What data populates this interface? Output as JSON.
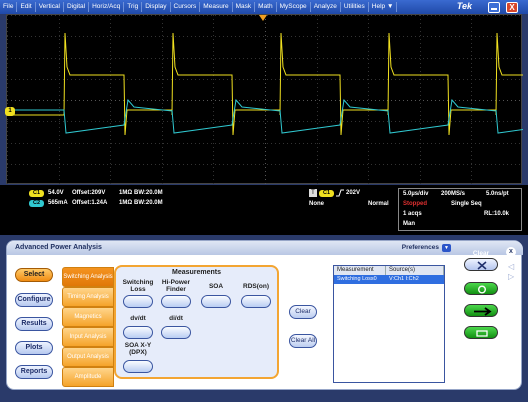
{
  "menu": [
    "File",
    "Edit",
    "Vertical",
    "Digital",
    "Horiz/Acq",
    "Trig",
    "Display",
    "Cursors",
    "Measure",
    "Mask",
    "Math",
    "MyScope",
    "Analyze",
    "Utilities",
    "Help"
  ],
  "help_arrow": "▼",
  "brand": "Tek",
  "close_glyph": "X",
  "colors": {
    "ch1": "#f0e020",
    "ch2": "#30c8d0",
    "accent": "#f39a1e",
    "menubar": "#2b5bc4"
  },
  "waveform": {
    "ch1_marker": "1",
    "icon_names": [
      "trigger-marker-icon",
      "ch1-ground-marker-icon",
      "ch2-ground-marker-icon"
    ]
  },
  "readout": {
    "ch1": {
      "badge": "C1",
      "scale": "54.0V",
      "offset": "Offset:209V",
      "impedance": "1MΩ",
      "bw": "BW:20.0M"
    },
    "ch2": {
      "badge": "C2",
      "scale": "565mA",
      "offset": "Offset:1.24A",
      "impedance": "1MΩ",
      "bw": "BW:20.0M"
    },
    "trigger": {
      "source": "C1",
      "level": "202V",
      "coupling": "None",
      "mode": "Normal",
      "slope_icon": "rising-edge-icon"
    },
    "acquisition": {
      "time_div": "5.0µs/div",
      "sample_rate": "200MS/s",
      "pt": "5.0ns/pt",
      "status": "Stopped",
      "seq": "Single Seq",
      "acqs": "1 acqs",
      "rl": "RL:10.0k",
      "mode": "Man"
    }
  },
  "panel": {
    "title": "Advanced Power Analysis",
    "preferences": "Preferences",
    "side_buttons": [
      "Select",
      "Configure",
      "Results",
      "Plots",
      "Reports"
    ],
    "tabs": [
      "Switching Analysis",
      "Timing Analysis",
      "Magnetics",
      "Input Analysis",
      "Output Analysis",
      "Amplitude"
    ],
    "measurements_heading": "Measurements",
    "measurements": [
      "Switching Loss",
      "Hi-Power Finder",
      "SOA",
      "RDS(on)",
      "dv/dt",
      "di/dt",
      "SOA X-Y (DPX)"
    ],
    "clear_button": "Clear",
    "clear_all_button": "Clear All",
    "table": {
      "headers": [
        "Measurement",
        "Source(s)"
      ],
      "rows": [
        {
          "measurement": "Switching Loss0",
          "sources": "V:Ch1 I:Ch2"
        }
      ]
    }
  },
  "right_controls": {
    "clear": "Clear",
    "recalc": "Recalc",
    "single": "Single",
    "run": "Run",
    "close_glyph": "x"
  }
}
